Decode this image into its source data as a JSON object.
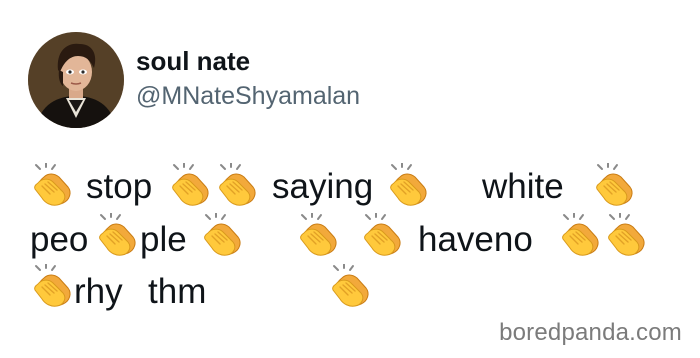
{
  "tweet": {
    "display_name": "soul nate",
    "handle": "@MNateShyamalan",
    "words": [
      "stop",
      "saying",
      "white",
      "peo",
      "ple",
      "haveno",
      "rhy",
      "thm"
    ],
    "emoji": "clapping-hands"
  },
  "watermark": "boredpanda.com"
}
